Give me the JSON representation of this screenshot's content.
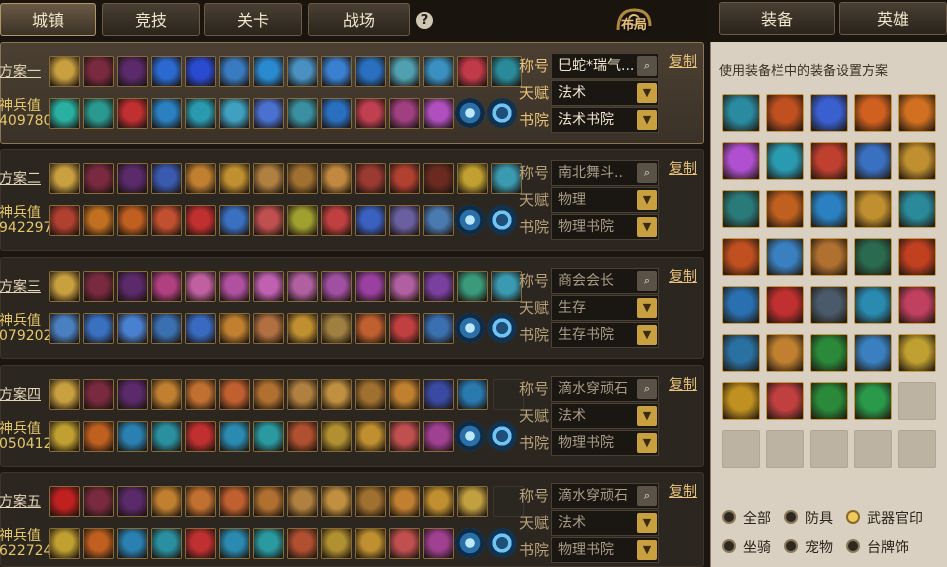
{
  "top_tabs": [
    {
      "label": "城镇",
      "active": true
    },
    {
      "label": "竞技",
      "active": false
    },
    {
      "label": "关卡",
      "active": false
    },
    {
      "label": "战场",
      "active": false
    }
  ],
  "help_label": "?",
  "logo_text": "布局",
  "right_tabs": [
    {
      "label": "装备"
    },
    {
      "label": "英雄"
    }
  ],
  "panel_description": "使用装备栏中的装备设置方案",
  "field_labels": {
    "title": "称号",
    "talent": "天赋",
    "academy": "书院"
  },
  "copy_label": "复制",
  "value_label": "神兵值",
  "plans": [
    {
      "name": "方案一",
      "value": "409780",
      "title": "巳蛇*瑞气...",
      "talent": "法术",
      "academy": "法术书院",
      "selected": true,
      "row1": [
        "#c9a040",
        "#7a2a40",
        "#5a2a6a",
        "#2a6ad0",
        "#2a4ad0",
        "#3a7ac0",
        "#2a8ad0",
        "#4a90c0",
        "#3a80d0",
        "#2a70c0",
        "#50a0b0",
        "#3a90c0",
        "#c03a4a",
        "#2a8a9a"
      ],
      "row2": [
        "#2ab0a0",
        "#2a9a90",
        "#c03030",
        "#2a80c0",
        "#2a9ab0",
        "#40a0c0",
        "#4a70d0",
        "#3a90a0",
        "#2a70c0",
        "#c04050",
        "#a04080",
        "#b050c0"
      ]
    },
    {
      "name": "方案二",
      "value": "942297",
      "title": "南北舞斗..",
      "talent": "物理",
      "academy": "物理书院",
      "selected": false,
      "row1": [
        "#c9a040",
        "#7a2a40",
        "#5a2a6a",
        "#3a5ab0",
        "#c08030",
        "#c09030",
        "#b08040",
        "#a07030",
        "#c08840",
        "#9a3a30",
        "#b04030",
        "#6a2a20",
        "#c0a030",
        "#3a9ab0"
      ],
      "row2": [
        "#b04030",
        "#c07020",
        "#c06020",
        "#c05030",
        "#c03030",
        "#3a70c0",
        "#c05050",
        "#a0a030",
        "#c04040",
        "#3a60c0",
        "#6a60a0",
        "#4a7ab0"
      ]
    },
    {
      "name": "方案三",
      "value": "079202",
      "title": "商会会长",
      "talent": "生存",
      "academy": "生存书院",
      "selected": false,
      "row1": [
        "#c9a040",
        "#7a2a40",
        "#5a2a6a",
        "#b04080",
        "#c060a0",
        "#b050a0",
        "#c060b0",
        "#b060a0",
        "#a050a0",
        "#9a40a0",
        "#b060a0",
        "#7a40a0",
        "#3a9a7a",
        "#3a9ab0"
      ],
      "row2": [
        "#4a80c0",
        "#3a70c0",
        "#4a80d0",
        "#3a70b0",
        "#3a6ac0",
        "#c08030",
        "#b07040",
        "#c09030",
        "#a08040",
        "#c06030",
        "#c04040",
        "#3a70b0"
      ]
    },
    {
      "name": "方案四",
      "value": "050412",
      "title": "滴水穿顽石",
      "talent": "法术",
      "academy": "物理书院",
      "selected": false,
      "row1": [
        "#c9a040",
        "#7a2a40",
        "#5a2a6a",
        "#c08030",
        "#c07030",
        "#c06030",
        "#b07030",
        "#b08040",
        "#c09040",
        "#a07030",
        "#c08030",
        "#3a4aa0",
        "#2a7ab0"
      ],
      "row2": [
        "#c0a030",
        "#c06020",
        "#2a80b0",
        "#2a90a0",
        "#c03030",
        "#2a8ab0",
        "#2a9aa0",
        "#b05030",
        "#b09030",
        "#c09030",
        "#c05050",
        "#a04090"
      ]
    },
    {
      "name": "方案五",
      "value": "622724",
      "title": "滴水穿顽石",
      "talent": "法术",
      "academy": "物理书院",
      "selected": false,
      "row1": [
        "#c02020",
        "#7a2a40",
        "#5a2a6a",
        "#c08030",
        "#c07030",
        "#c06030",
        "#b07030",
        "#b08040",
        "#c09040",
        "#a07030",
        "#c08030",
        "#c09030",
        "#c0a040"
      ],
      "row2": [
        "#c0a030",
        "#c06020",
        "#2a80b0",
        "#2a90a0",
        "#c03030",
        "#2a8ab0",
        "#2a9aa0",
        "#b05030",
        "#b09030",
        "#c09030",
        "#c05050",
        "#a04090"
      ]
    }
  ],
  "equipment_grid": [
    [
      "#2a8aa0",
      "#c05020",
      "#3a60d0",
      "#d06020",
      "#d07020"
    ],
    [
      "#b050d0",
      "#2a9ab0",
      "#c04030",
      "#3a70c0",
      "#c09030"
    ],
    [
      "#2a7a7a",
      "#c06020",
      "#2a80c0",
      "#c09030",
      "#2a8a9a"
    ],
    [
      "#c05020",
      "#3a80c0",
      "#b07030",
      "#2a6a50",
      "#c04020"
    ],
    [
      "#2a70b0",
      "#c03030",
      "#4a5a6a",
      "#2a8ab0",
      "#c04060"
    ],
    [
      "#2a70a0",
      "#c08030",
      "#2a8a3a",
      "#3a80c0",
      "#c0a030"
    ],
    [
      "#c09020",
      "#c04040",
      "#2a8a3a",
      "#2a9a4a",
      ""
    ],
    [
      "",
      "",
      "",
      "",
      ""
    ]
  ],
  "filters": [
    {
      "label": "全部",
      "checked": false
    },
    {
      "label": "防具",
      "checked": false
    },
    {
      "label": "武器官印",
      "checked": true
    },
    {
      "label": "坐骑",
      "checked": false
    },
    {
      "label": "宠物",
      "checked": false
    },
    {
      "label": "台牌饰",
      "checked": false
    }
  ]
}
